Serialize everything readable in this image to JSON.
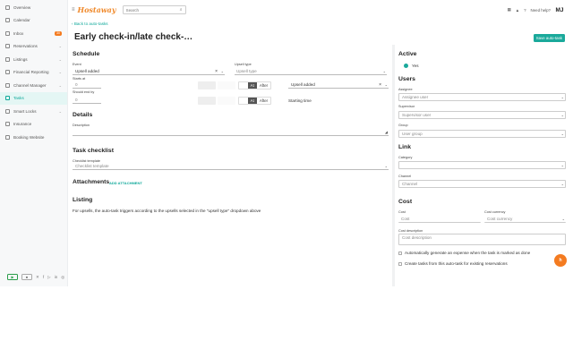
{
  "sidebar": {
    "items": [
      {
        "label": "Overview"
      },
      {
        "label": "Calendar"
      },
      {
        "label": "Inbox",
        "badge": "30"
      },
      {
        "label": "Reservations"
      },
      {
        "label": "Listings"
      },
      {
        "label": "Financial Reporting"
      },
      {
        "label": "Channel Manager"
      },
      {
        "label": "Tasks",
        "active": true
      },
      {
        "label": "Smart Locks"
      },
      {
        "label": "Insurance"
      },
      {
        "label": "Booking Website"
      }
    ]
  },
  "topbar": {
    "logo": "Hostaway",
    "search_placeholder": "Search",
    "help": "Need help?",
    "avatar": "MJ"
  },
  "header": {
    "back": "Back to auto-tasks",
    "title": "Early check-in/late check-…",
    "save": "Save auto-task"
  },
  "schedule": {
    "heading": "Schedule",
    "event_label": "Event",
    "event_value": "Upsell added",
    "upsell_type_label": "Upsell type",
    "upsell_type_placeholder": "Upsell type",
    "starts_at_label": "Starts at",
    "starts_at_value": "0",
    "at": "At",
    "after": "After",
    "starts_event": "Upsell added",
    "should_end_label": "Should end by",
    "should_end_value": "0",
    "end_ref": "Starting time"
  },
  "details": {
    "heading": "Details",
    "description_label": "Description"
  },
  "checklist": {
    "heading": "Task checklist",
    "template_label": "Checklist template",
    "template_placeholder": "Checklist template"
  },
  "attachments": {
    "heading": "Attachments",
    "add": "ADD ATTACHMENT"
  },
  "listing": {
    "heading": "Listing",
    "note": "For upsells, the auto-task triggers according to the upsells selected in the \"upsell type\" dropdown above"
  },
  "right": {
    "active_heading": "Active",
    "active_value": "Yes",
    "users_heading": "Users",
    "assignee_label": "Assignee",
    "assignee_placeholder": "Assignee user",
    "supervisor_label": "Supervisor",
    "supervisor_placeholder": "Supervisor user",
    "group_label": "Group",
    "group_placeholder": "User group",
    "link_heading": "Link",
    "category_label": "Category",
    "channel_label": "Channel",
    "channel_placeholder": "Channel",
    "cost_heading": "Cost",
    "cost_label": "Cost",
    "cost_placeholder": "Cost",
    "currency_label": "Cost currency",
    "currency_placeholder": "Cost currency",
    "cost_desc_label": "Cost description",
    "cost_desc_placeholder": "Cost description",
    "auto_expense": "Automatically generate an expense when the task is marked as done",
    "create_tasks": "Create tasks from this auto-task for existing reservations"
  },
  "colors": {
    "accent": "#1aa99b",
    "orange": "#f47b20"
  }
}
